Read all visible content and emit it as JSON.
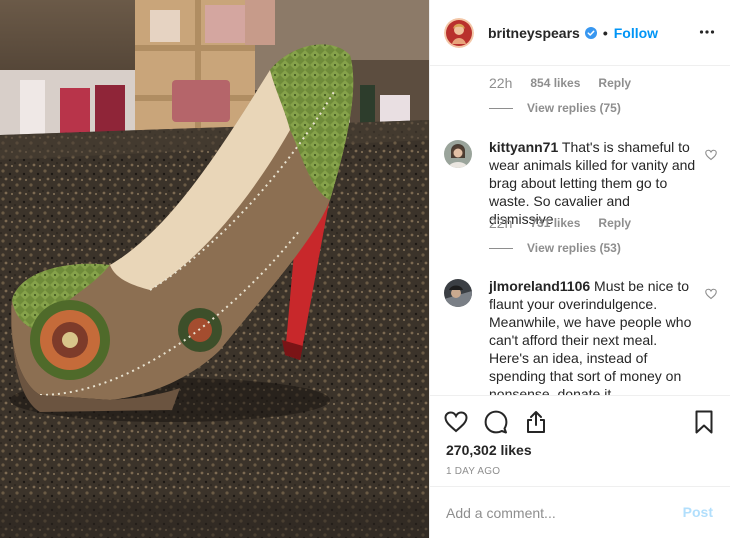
{
  "post": {
    "photo_alt_name": "shoe-photo",
    "username": "britneyspears",
    "verified": true,
    "separator": "•",
    "follow_label": "Follow",
    "likes": "270,302 likes",
    "date": "1 DAY AGO"
  },
  "comments": [
    {
      "time": "22h",
      "likes": "854 likes",
      "reply": "Reply",
      "view_replies": "View replies (75)"
    },
    {
      "username": "kittyann71",
      "text": " That's is shameful to wear animals killed for vanity and brag about letting them go to waste. So cavalier and dismissive",
      "time": "22h",
      "likes": "731 likes",
      "reply": "Reply",
      "view_replies": "View replies (53)"
    },
    {
      "username": "jlmoreland1106",
      "text": " Must be nice to flaunt your overindulgence. Meanwhile, we have people who can't afford their next meal. Here's an idea, instead of spending that sort of money on nonsense, donate it."
    }
  ],
  "composer": {
    "placeholder": "Add a comment...",
    "post_label": "Post"
  },
  "colors": {
    "accent": "#0095f6",
    "muted": "#8e8e8e",
    "text": "#262626",
    "post_disabled": "#b2dffc"
  },
  "icons": [
    "more-icon",
    "verified-icon",
    "heart-icon",
    "comment-icon",
    "share-icon",
    "bookmark-icon",
    "small-heart-icon"
  ]
}
